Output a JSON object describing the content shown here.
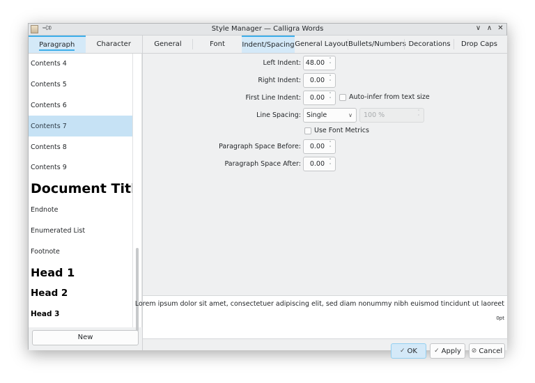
{
  "window": {
    "title": "Style Manager — Calligra Words",
    "buttons": [
      "∨",
      "∧",
      "✕"
    ]
  },
  "left_tabs": [
    {
      "label": "Paragraph",
      "active": true
    },
    {
      "label": "Character",
      "active": false
    }
  ],
  "style_list": [
    {
      "label": "Contents 4",
      "style": "normal"
    },
    {
      "label": "Contents 5",
      "style": "normal"
    },
    {
      "label": "Contents 6",
      "style": "normal"
    },
    {
      "label": "Contents 7",
      "style": "normal",
      "selected": true
    },
    {
      "label": "Contents 8",
      "style": "normal"
    },
    {
      "label": "Contents 9",
      "style": "normal"
    },
    {
      "label": "Document Title",
      "style": "doc-title"
    },
    {
      "label": "Endnote",
      "style": "normal"
    },
    {
      "label": "Enumerated List",
      "style": "normal"
    },
    {
      "label": "Footnote",
      "style": "normal"
    },
    {
      "label": "Head 1",
      "style": "h1"
    },
    {
      "label": "Head 2",
      "style": "h2"
    },
    {
      "label": "Head 3",
      "style": "h3"
    }
  ],
  "new_button": "New",
  "right_tabs": [
    {
      "label": "General",
      "active": false
    },
    {
      "label": "Font",
      "active": false
    },
    {
      "label": "Indent/Spacing",
      "active": true
    },
    {
      "label": "General Layout",
      "active": false
    },
    {
      "label": "Bullets/Numbers",
      "active": false
    },
    {
      "label": "Decorations",
      "active": false
    },
    {
      "label": "Drop Caps",
      "active": false
    }
  ],
  "form": {
    "left_indent": {
      "label": "Left Indent:",
      "value": "48.00"
    },
    "right_indent": {
      "label": "Right Indent:",
      "value": "0.00"
    },
    "first_line_indent": {
      "label": "First Line Indent:",
      "value": "0.00"
    },
    "auto_infer": {
      "label": "Auto-infer from text size",
      "checked": false
    },
    "line_spacing": {
      "label": "Line Spacing:",
      "value": "Single",
      "percent": "100 %"
    },
    "use_font_metrics": {
      "label": "Use Font Metrics",
      "checked": false
    },
    "space_before": {
      "label": "Paragraph Space Before:",
      "value": "0.00"
    },
    "space_after": {
      "label": "Paragraph Space After:",
      "value": "0.00"
    }
  },
  "preview": {
    "text": "Lorem ipsum dolor sit amet, consectetuer adipiscing elit, sed diam nonummy nibh euismod tincidunt ut laoreet",
    "unit": "0pt"
  },
  "buttons": {
    "ok": "OK",
    "apply": "Apply",
    "cancel": "Cancel"
  },
  "icons": {
    "check": "✓",
    "cancel": "⃠",
    "spin": "˄˅",
    "chevron": "∨"
  }
}
